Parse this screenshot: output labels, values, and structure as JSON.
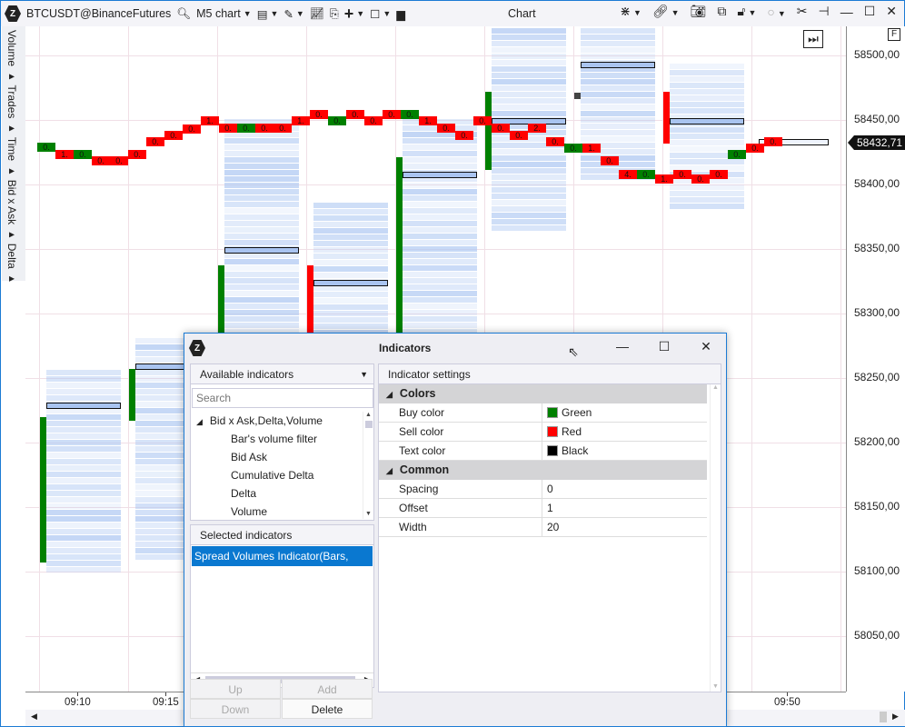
{
  "toolbar": {
    "symbol": "BTCUSDT@BinanceFutures",
    "timeframe": "M5 chart",
    "window_title": "Chart",
    "icons": [
      "search-icon",
      "template-icon",
      "pencil-icon",
      "indicators-icon",
      "scroll-icon",
      "crosshair-icon",
      "layout-icon",
      "dom-icon",
      "cross-icon",
      "link-icon",
      "camera-icon",
      "copy-icon",
      "lock-icon",
      "circle-icon",
      "tools-icon",
      "pin-icon"
    ]
  },
  "window_controls": {
    "minimize": "—",
    "maximize": "☐",
    "close": "✕"
  },
  "left_panel": {
    "label": "Volume ▸ Trades ▸ Time ▸ Bid x Ask ▸ Delta ▸"
  },
  "chart": {
    "price_labels": [
      "58500,00",
      "58450,00",
      "58400,00",
      "58350,00",
      "58300,00",
      "58250,00",
      "58200,00",
      "58150,00",
      "58100,00",
      "58050,00"
    ],
    "price_ticks": [
      58500,
      58450,
      58400,
      58350,
      58300,
      58250,
      58200,
      58150,
      58100,
      58050
    ],
    "current_price": "58432,71",
    "current_price_value": 58432.71,
    "time_labels": [
      "09:10",
      "09:15",
      "09:50"
    ],
    "colors": {
      "buy": "#008000",
      "sell": "#ff0000",
      "profile": "#aec8f2",
      "poc": "#a9c4f0"
    },
    "f_button": "F",
    "bars": [
      {
        "dir": "buy",
        "open": 58107,
        "close": 58220,
        "profile": [
          58102,
          58256
        ],
        "poc": 58229
      },
      {
        "dir": "buy",
        "open": 58217,
        "close": 58257,
        "profile": [
          58113,
          58281
        ],
        "poc": 58259
      },
      {
        "dir": "buy",
        "open": 58250,
        "close": 58337,
        "profile": [
          58100,
          58451
        ],
        "poc": 58349
      },
      {
        "dir": "sell",
        "open": 58337,
        "close": 58285,
        "profile": [
          58120,
          58386
        ],
        "poc": 58324
      },
      {
        "dir": "buy",
        "open": 58285,
        "close": 58421,
        "profile": [
          58150,
          58451
        ],
        "poc": 58408
      },
      {
        "dir": "buy",
        "open": 58411,
        "close": 58472,
        "profile": [
          58368,
          58521
        ],
        "poc": 58449
      },
      {
        "dir": "doji",
        "open": 58469,
        "close": 58469,
        "profile": [
          58405,
          58521
        ],
        "poc": 58493
      },
      {
        "dir": "sell",
        "open": 58472,
        "close": 58432,
        "profile": [
          58382,
          58494
        ],
        "poc": 58449
      },
      {
        "dir": "current",
        "poc": 58433
      }
    ],
    "delta_markers": [
      {
        "p": 58429,
        "c": "buy",
        "t": "0."
      },
      {
        "p": 58423,
        "c": "sell",
        "t": "1."
      },
      {
        "p": 58423,
        "c": "buy",
        "t": "0."
      },
      {
        "p": 58418,
        "c": "sell",
        "t": "0."
      },
      {
        "p": 58418,
        "c": "sell",
        "t": "0."
      },
      {
        "p": 58423,
        "c": "sell",
        "t": "0."
      },
      {
        "p": 58433,
        "c": "sell",
        "t": "0."
      },
      {
        "p": 58438,
        "c": "sell",
        "t": "0."
      },
      {
        "p": 58443,
        "c": "sell",
        "t": "0."
      },
      {
        "p": 58449,
        "c": "sell",
        "t": "1."
      },
      {
        "p": 58444,
        "c": "sell",
        "t": "0."
      },
      {
        "p": 58444,
        "c": "buy",
        "t": "0."
      },
      {
        "p": 58444,
        "c": "sell",
        "t": "0."
      },
      {
        "p": 58444,
        "c": "sell",
        "t": "0."
      },
      {
        "p": 58449,
        "c": "sell",
        "t": "1."
      },
      {
        "p": 58454,
        "c": "sell",
        "t": "0."
      },
      {
        "p": 58449,
        "c": "buy",
        "t": "0."
      },
      {
        "p": 58454,
        "c": "sell",
        "t": "0."
      },
      {
        "p": 58449,
        "c": "sell",
        "t": "0."
      },
      {
        "p": 58454,
        "c": "sell",
        "t": "0."
      },
      {
        "p": 58454,
        "c": "buy",
        "t": "0."
      },
      {
        "p": 58449,
        "c": "sell",
        "t": "1."
      },
      {
        "p": 58444,
        "c": "sell",
        "t": "0."
      },
      {
        "p": 58438,
        "c": "sell",
        "t": "0."
      },
      {
        "p": 58449,
        "c": "sell",
        "t": "0."
      },
      {
        "p": 58444,
        "c": "sell",
        "t": "0."
      },
      {
        "p": 58438,
        "c": "sell",
        "t": "0."
      },
      {
        "p": 58444,
        "c": "sell",
        "t": "2."
      },
      {
        "p": 58433,
        "c": "sell",
        "t": "0."
      },
      {
        "p": 58428,
        "c": "buy",
        "t": "0."
      },
      {
        "p": 58428,
        "c": "sell",
        "t": "1."
      },
      {
        "p": 58418,
        "c": "sell",
        "t": "0."
      },
      {
        "p": 58408,
        "c": "sell",
        "t": "4."
      },
      {
        "p": 58408,
        "c": "buy",
        "t": "0."
      },
      {
        "p": 58404,
        "c": "sell",
        "t": "1."
      },
      {
        "p": 58408,
        "c": "sell",
        "t": "0."
      },
      {
        "p": 58404,
        "c": "sell",
        "t": "0."
      },
      {
        "p": 58408,
        "c": "sell",
        "t": "0."
      },
      {
        "p": 58423,
        "c": "buy",
        "t": "0."
      },
      {
        "p": 58428,
        "c": "sell",
        "t": "0."
      },
      {
        "p": 58433,
        "c": "sell",
        "t": "0."
      }
    ]
  },
  "dialog": {
    "title": "Indicators",
    "available_header": "Available indicators",
    "search_placeholder": "Search",
    "tree_group": "Bid x Ask,Delta,Volume",
    "tree_items": [
      "Bar's volume filter",
      "Bid Ask",
      "Cumulative Delta",
      "Delta",
      "Volume"
    ],
    "selected_header": "Selected indicators",
    "selected_items": [
      "Spread Volumes Indicator(Bars, True)"
    ],
    "buttons": {
      "up": "Up",
      "add": "Add",
      "down": "Down",
      "delete": "Delete"
    },
    "settings_header": "Indicator settings",
    "categories": [
      {
        "name": "Colors",
        "rows": [
          {
            "key": "Buy color",
            "value": "Green",
            "swatch": "#008000"
          },
          {
            "key": "Sell color",
            "value": "Red",
            "swatch": "#ff0000"
          },
          {
            "key": "Text color",
            "value": "Black",
            "swatch": "#000000"
          }
        ]
      },
      {
        "name": "Common",
        "rows": [
          {
            "key": "Spacing",
            "value": "0"
          },
          {
            "key": "Offset",
            "value": "1"
          },
          {
            "key": "Width",
            "value": "20"
          }
        ]
      }
    ]
  }
}
